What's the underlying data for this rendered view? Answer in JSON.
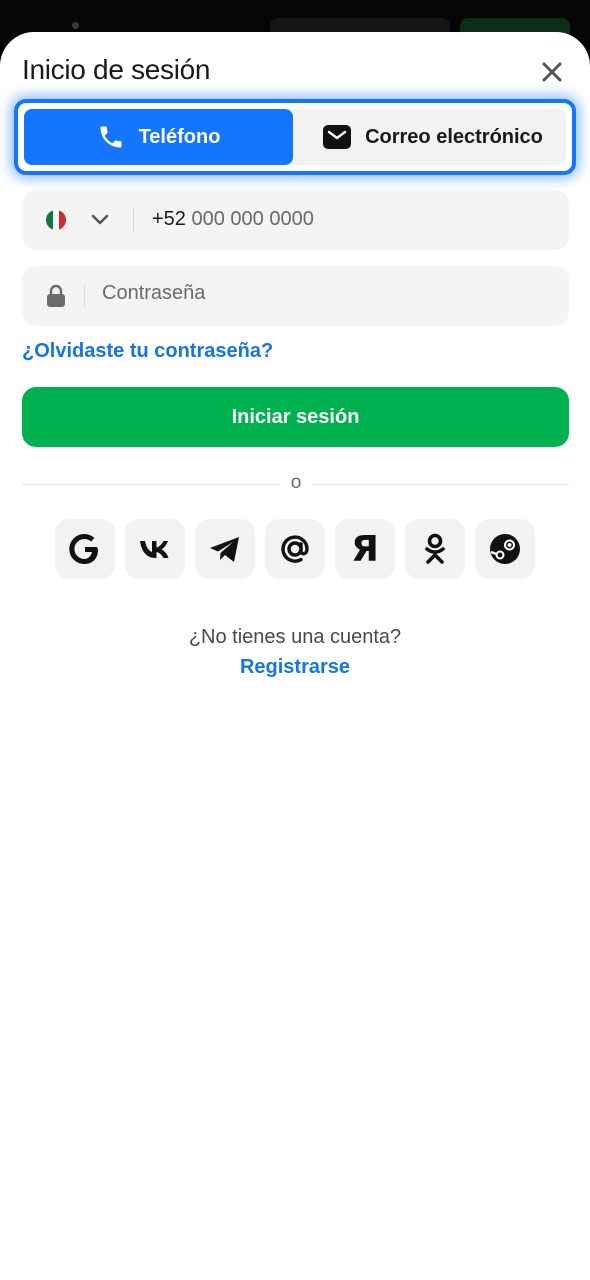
{
  "header": {
    "title": "Inicio de sesión"
  },
  "tabs": [
    {
      "label": "Teléfono",
      "icon": "phone-icon",
      "active": true
    },
    {
      "label": "Correo electrónico",
      "icon": "mail-icon",
      "active": false
    }
  ],
  "phone_field": {
    "country_code": "+52",
    "placeholder": "000 000 0000",
    "country": "México"
  },
  "password_field": {
    "placeholder": "Contraseña"
  },
  "forgot_label": "¿Olvidaste tu contraseña?",
  "login_label": "Iniciar sesión",
  "separator_label": "o",
  "social": [
    "google-icon",
    "vk-icon",
    "telegram-icon",
    "mail-at-icon",
    "yandex-icon",
    "odnoklassniki-icon",
    "steam-icon"
  ],
  "signup": {
    "question": "¿No tienes una cuenta?",
    "link": "Registrarse"
  },
  "colors": {
    "accent": "#1475ff",
    "link": "#1475e6",
    "primary_button": "#00b14f",
    "field_bg": "#f4f4f5"
  }
}
